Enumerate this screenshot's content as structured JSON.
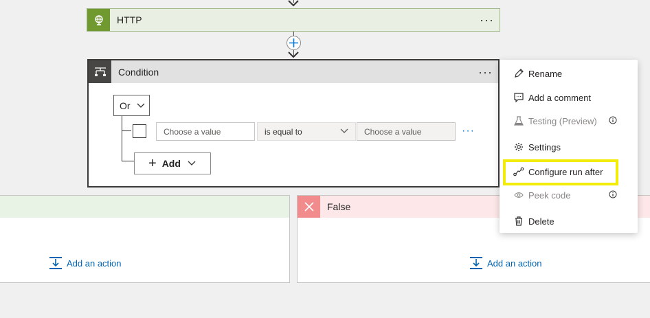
{
  "http_step": {
    "title": "HTTP",
    "more": "···"
  },
  "condition": {
    "title": "Condition",
    "more": "···",
    "group_operator": "Or",
    "row": {
      "left_placeholder": "Choose a value",
      "operator": "is equal to",
      "right_placeholder": "Choose a value",
      "more": "···"
    },
    "add_label": "Add"
  },
  "branches": {
    "true_add_action": "Add an action",
    "false_title": "False",
    "false_add_action": "Add an action"
  },
  "context_menu": {
    "items": [
      {
        "label": "Rename",
        "icon": "pencil-icon"
      },
      {
        "label": "Add a comment",
        "icon": "comment-icon"
      },
      {
        "label": "Testing (Preview)",
        "icon": "beaker-icon",
        "disabled": true
      },
      {
        "label": "Settings",
        "icon": "gear-icon"
      },
      {
        "label": "Configure run after",
        "icon": "run-after-icon",
        "highlighted": true
      },
      {
        "label": "Peek code",
        "icon": "eye-icon",
        "disabled": true
      },
      {
        "label": "Delete",
        "icon": "trash-icon"
      }
    ]
  },
  "colors": {
    "http_accent": "#70992f",
    "condition_accent": "#484644",
    "false_accent": "#f28b8b",
    "highlight": "#f2ec0b",
    "link": "#0063b1"
  }
}
